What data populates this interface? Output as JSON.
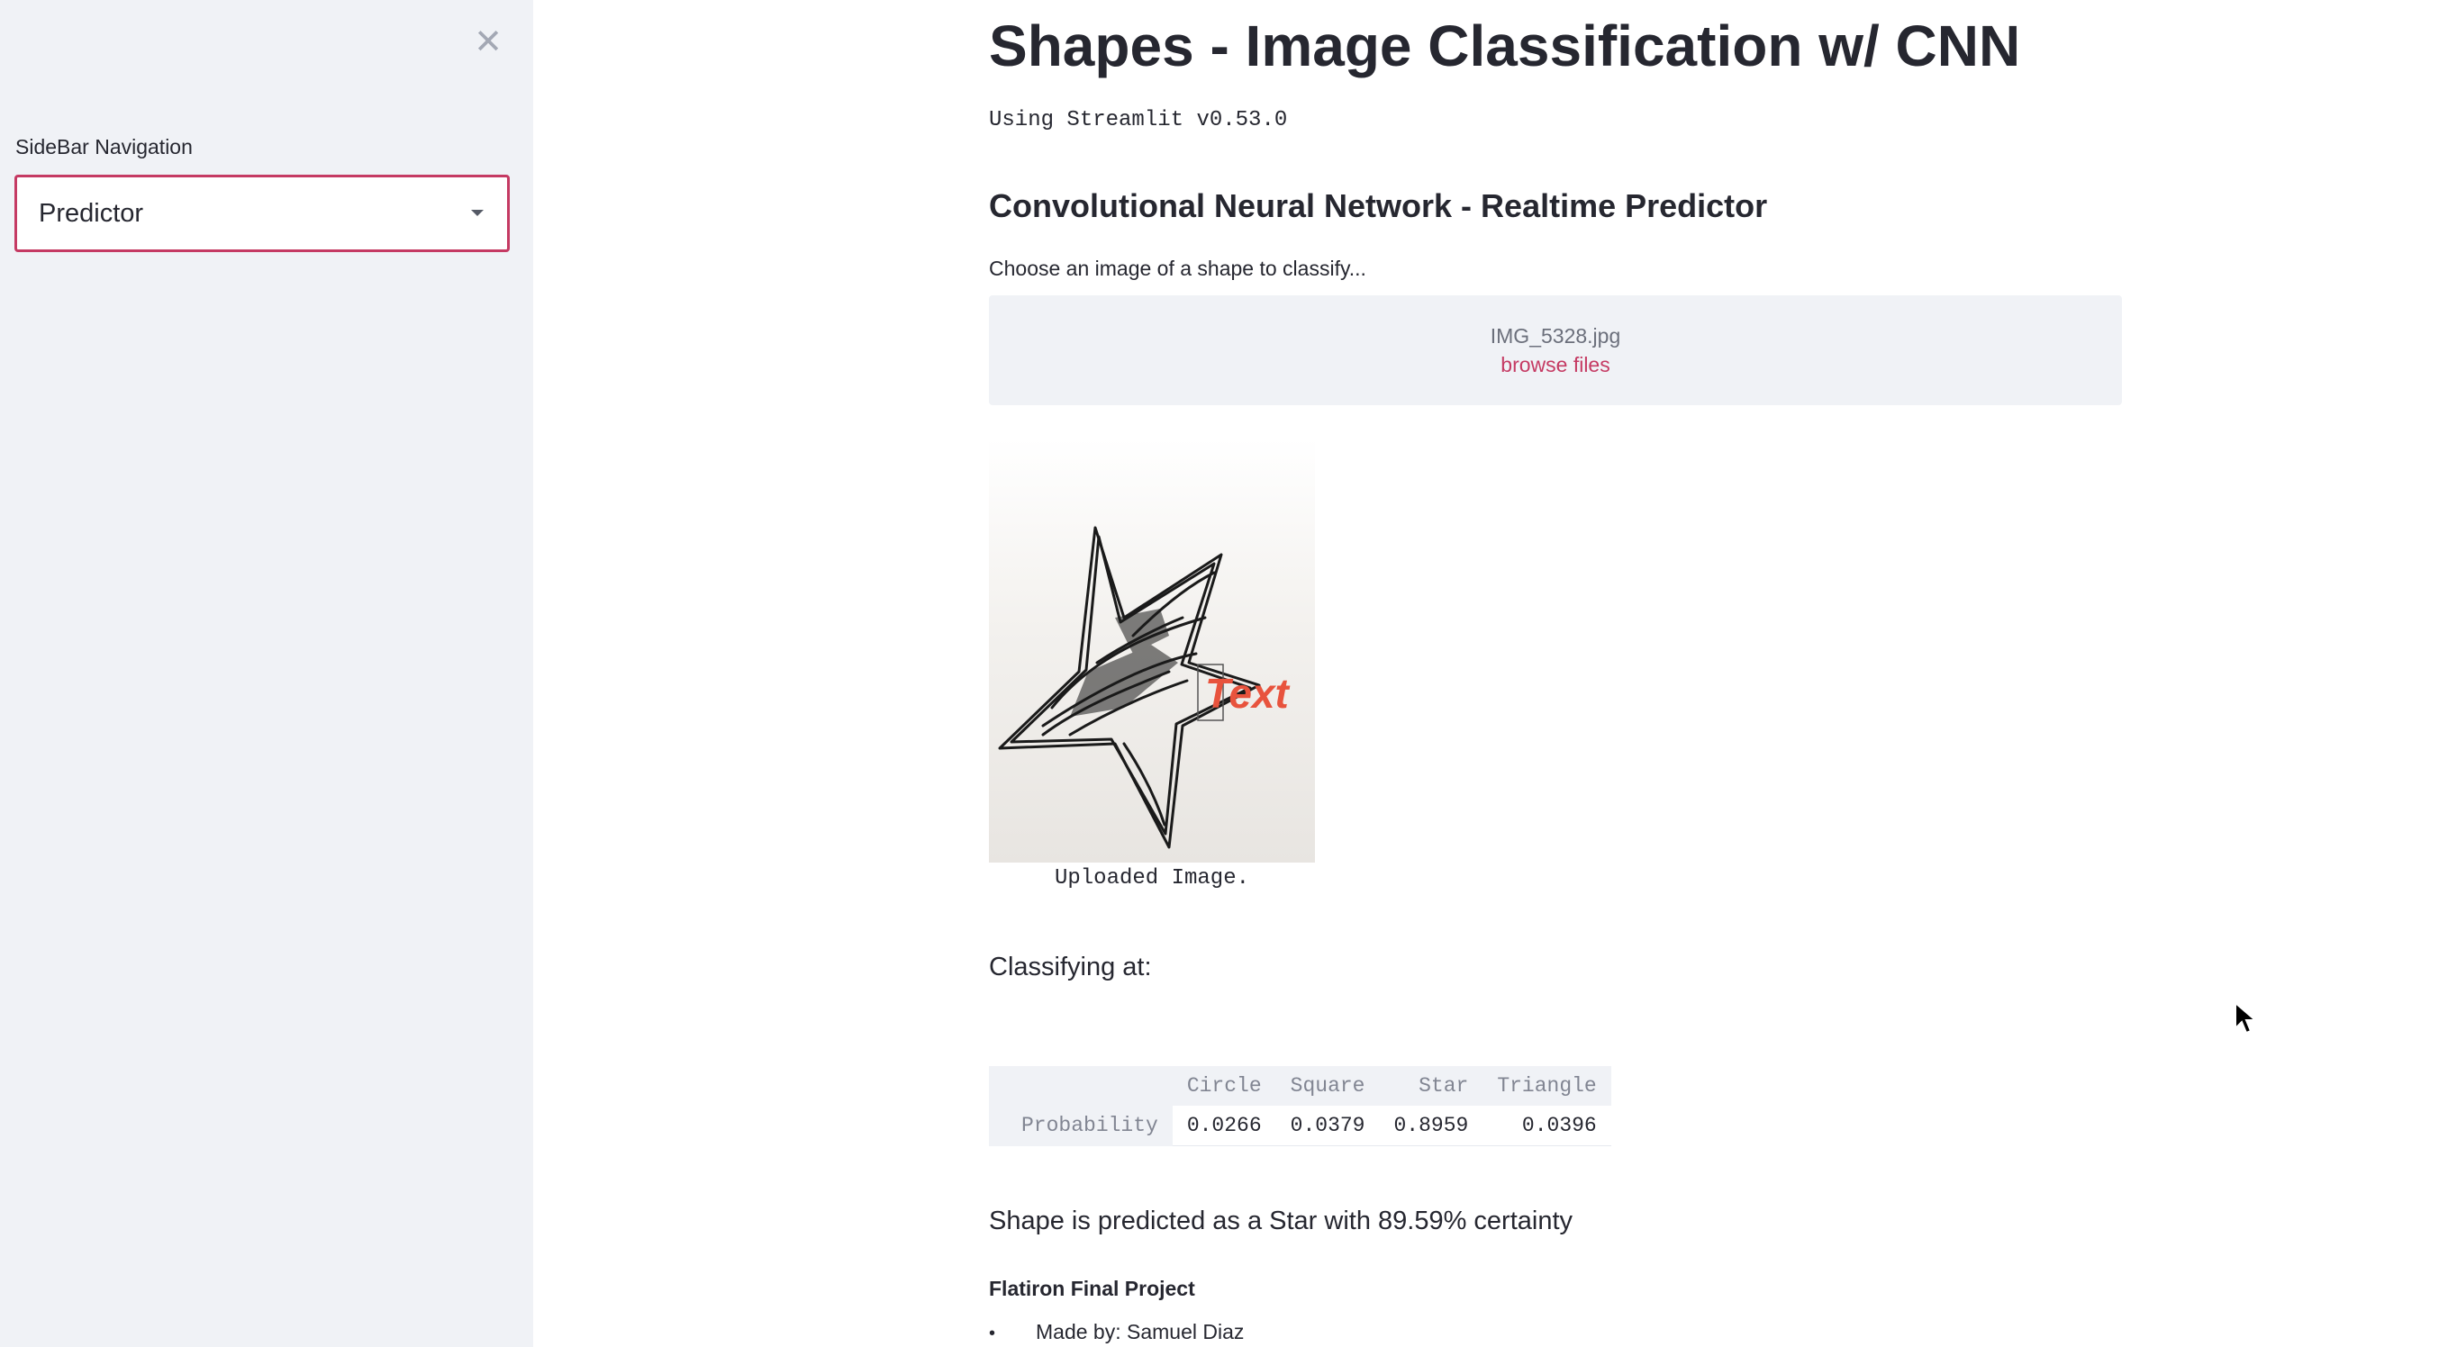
{
  "sidebar": {
    "close_glyph": "✕",
    "nav_label": "SideBar Navigation",
    "select_value": "Predictor"
  },
  "main": {
    "title": "Shapes - Image Classification w/ CNN",
    "version_text": "Using Streamlit v0.53.0",
    "section_heading": "Convolutional Neural Network - Realtime Predictor",
    "uploader": {
      "label": "Choose an image of a shape to classify...",
      "file_name": "IMG_5328.jpg",
      "browse_label": "browse files"
    },
    "image": {
      "overlay_text": "Text",
      "caption": "Uploaded Image."
    },
    "classifying_label": "Classifying at:",
    "table": {
      "columns": [
        "Circle",
        "Square",
        "Star",
        "Triangle"
      ],
      "row_label": "Probability",
      "values": [
        "0.0266",
        "0.0379",
        "0.8959",
        "0.0396"
      ]
    },
    "prediction": "Shape is predicted as a Star with 89.59% certainty",
    "footer": {
      "heading": "Flatiron Final Project",
      "bullet": "•",
      "items": [
        "Made by: Samuel Diaz"
      ]
    }
  },
  "colors": {
    "accent": "#c53a63",
    "sidebar_bg": "#f0f2f6",
    "text": "#262730"
  },
  "icons": {
    "close": "close-icon",
    "caret": "chevron-down-icon",
    "cursor": "mouse-pointer-icon"
  }
}
